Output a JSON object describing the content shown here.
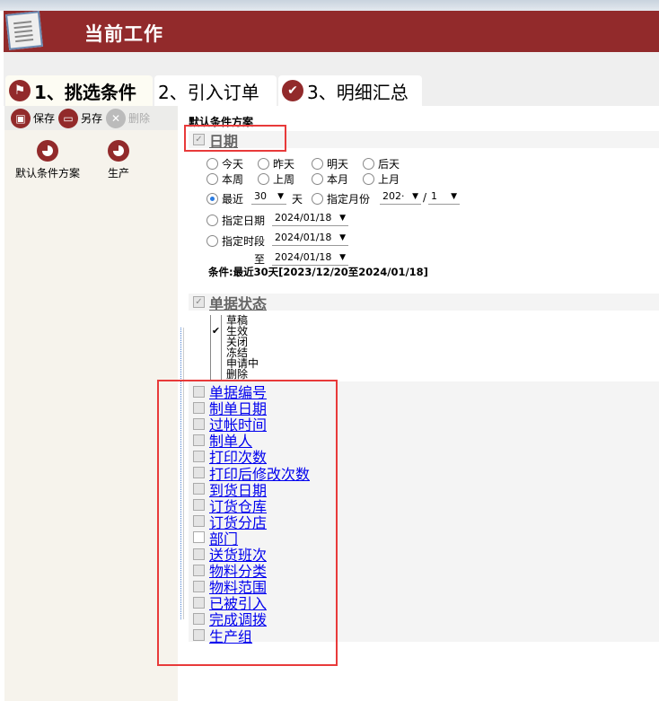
{
  "header": {
    "title": "当前工作"
  },
  "tabs": [
    {
      "label": "1、挑选条件",
      "icon": "flag-icon",
      "active": true
    },
    {
      "label": "2、引入订单"
    },
    {
      "label": "3、明细汇总",
      "icon": "check-icon"
    }
  ],
  "toolbar": {
    "save": "保存",
    "save_as": "另存",
    "delete": "删除"
  },
  "schemes": [
    {
      "label": "默认条件方案",
      "icon": "pie-chart-icon"
    },
    {
      "label": "生产",
      "icon": "pie-chart-icon"
    }
  ],
  "scheme_title": "默认条件方案",
  "date_section": {
    "label": "日期",
    "checked": true,
    "quick": [
      "今天",
      "昨天",
      "明天",
      "后天",
      "本周",
      "上周",
      "本月",
      "上月"
    ],
    "recent_label": "最近",
    "recent_value": "30",
    "day_unit": "天",
    "recent_selected": true,
    "month_label": "指定月份",
    "month_year": "202·",
    "month_sep": "/",
    "month_value": "1",
    "date_label": "指定日期",
    "date_value": "2024/01/18",
    "range_label": "指定时段",
    "range_from": "2024/01/18",
    "range_to_label": "至",
    "range_to": "2024/01/18",
    "condition": "条件:最近30天[2023/12/20至2024/01/18]"
  },
  "status_section": {
    "label": "单据状态",
    "checked": true,
    "items": [
      {
        "label": "草稿",
        "checked": false
      },
      {
        "label": "生效",
        "checked": true
      },
      {
        "label": "关闭",
        "checked": false
      },
      {
        "label": "冻结",
        "checked": false
      },
      {
        "label": "申请中",
        "checked": false
      },
      {
        "label": "删除",
        "checked": false
      }
    ]
  },
  "fields": [
    "单据编号",
    "制单日期",
    "过帐时间",
    "制单人",
    "打印次数",
    "打印后修改次数",
    "到货日期",
    "订货仓库",
    "订货分店",
    "部门",
    "送货班次",
    "物料分类",
    "物料范围",
    "已被引入",
    "完成调拨",
    "生产组"
  ],
  "colors": {
    "brand": "#922a2b",
    "link": "#0000ee",
    "highlight": "#e83a3a"
  }
}
